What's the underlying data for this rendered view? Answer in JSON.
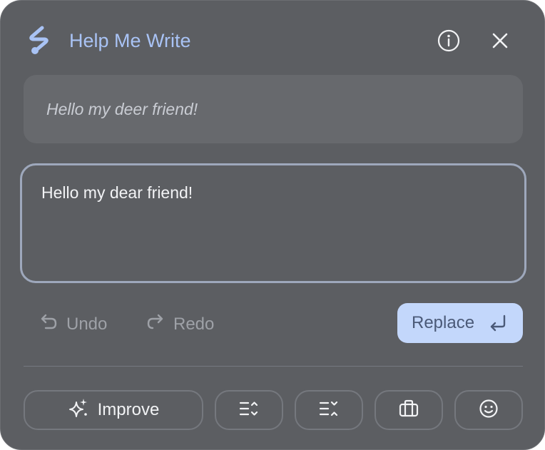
{
  "header": {
    "title": "Help Me Write",
    "logo_icon": "lightning-pen-icon",
    "info_icon": "info-circle-icon",
    "close_icon": "close-icon"
  },
  "original": {
    "text": "Hello my deer friend!"
  },
  "editor": {
    "text": "Hello my dear friend!"
  },
  "actions": {
    "undo_label": "Undo",
    "undo_icon": "undo-arrow-icon",
    "redo_label": "Redo",
    "redo_icon": "redo-arrow-icon",
    "replace_label": "Replace",
    "replace_icon": "enter-return-icon"
  },
  "tools": {
    "improve_label": "Improve",
    "improve_icon": "sparkles-icon",
    "shorten_icon": "shorten-lines-icon",
    "elaborate_icon": "expand-lines-icon",
    "formal_icon": "briefcase-icon",
    "casual_icon": "smiley-icon"
  },
  "colors": {
    "background": "#5c5e62",
    "title": "#a9c3f5",
    "replace_button": "#c3d7fb",
    "edit_border": "#9ea8bc"
  }
}
